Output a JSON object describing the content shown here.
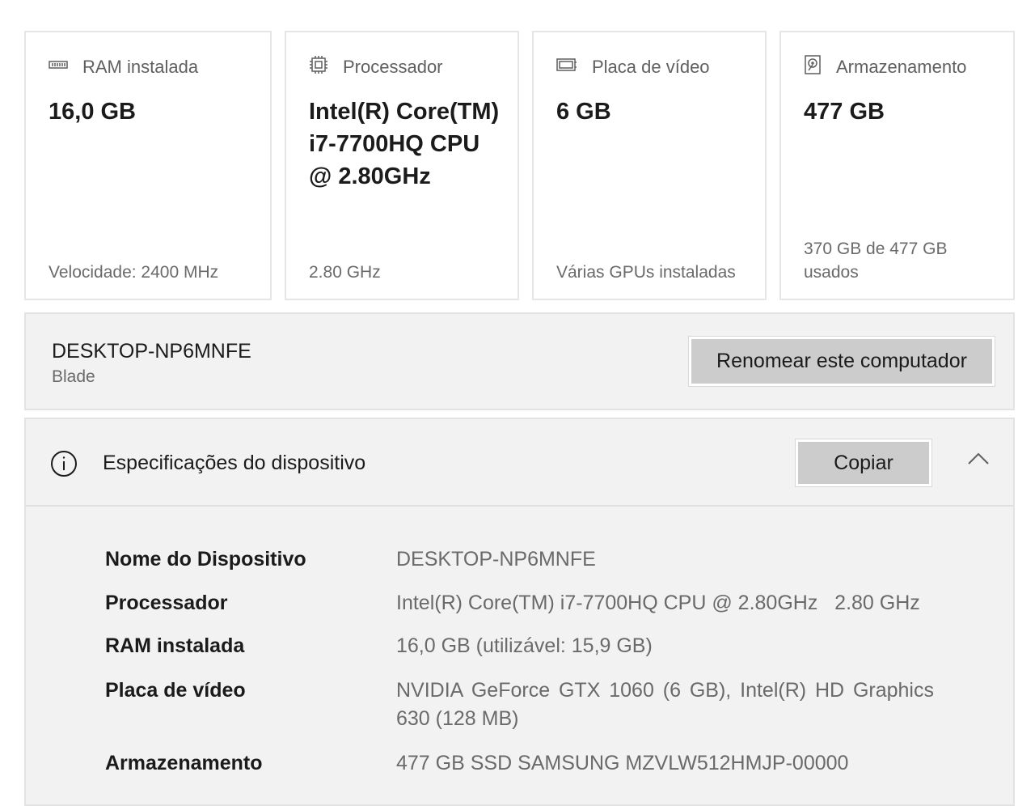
{
  "cards": [
    {
      "title": "RAM instalada",
      "icon": "ram-icon",
      "value": "16,0 GB",
      "footer": "Velocidade: 2400 MHz"
    },
    {
      "title": "Processador",
      "icon": "cpu-icon",
      "value": "Intel(R) Core(TM) i7-7700HQ CPU @ 2.80GHz",
      "footer": "2.80 GHz"
    },
    {
      "title": "Placa de vídeo",
      "icon": "gpu-icon",
      "value": "6 GB",
      "footer": "Várias GPUs instaladas"
    },
    {
      "title": "Armazenamento",
      "icon": "storage-icon",
      "value": "477 GB",
      "footer": "370 GB de 477 GB usados"
    }
  ],
  "pc": {
    "name": "DESKTOP-NP6MNFE",
    "model": "Blade",
    "rename_label": "Renomear este computador"
  },
  "specs": {
    "title": "Especificações do dispositivo",
    "copy_label": "Copiar",
    "rows": [
      {
        "label": "Nome do Dispositivo",
        "value": "DESKTOP-NP6MNFE"
      },
      {
        "label": "Processador",
        "value": "Intel(R) Core(TM) i7-7700HQ CPU @ 2.80GHz   2.80 GHz"
      },
      {
        "label": "RAM instalada",
        "value": "16,0 GB (utilizável: 15,9 GB)"
      },
      {
        "label": "Placa de vídeo",
        "value": "NVIDIA GeForce GTX 1060 (6 GB), Intel(R) HD Graphics 630 (128 MB)"
      },
      {
        "label": "Armazenamento",
        "value": "477 GB SSD SAMSUNG MZVLW512HMJP-00000"
      }
    ]
  }
}
